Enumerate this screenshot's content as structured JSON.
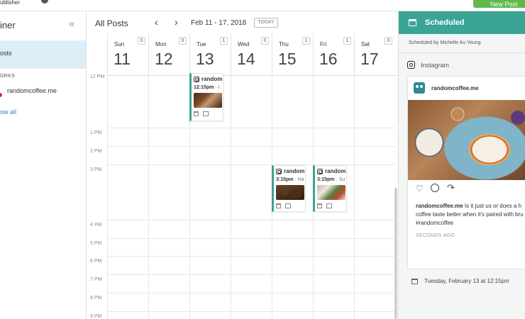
{
  "topbar": {
    "publisher": "ublisher",
    "new_post": "New Post"
  },
  "sidebar": {
    "title": "iner",
    "all_posts": "osts",
    "networks_label": "ORKS",
    "account": "randomcoffee.me",
    "show_all": "ow all"
  },
  "calendar": {
    "title": "All Posts",
    "date_range": "Feb 11 - 17, 2018",
    "today": "TODAY",
    "days": [
      {
        "name": "Sun",
        "num": "11",
        "count": "0"
      },
      {
        "name": "Mon",
        "num": "12",
        "count": "0"
      },
      {
        "name": "Tue",
        "num": "13",
        "count": "1"
      },
      {
        "name": "Wed",
        "num": "14",
        "count": "0"
      },
      {
        "name": "Thu",
        "num": "15",
        "count": "1"
      },
      {
        "name": "Fri",
        "num": "16",
        "count": "1"
      },
      {
        "name": "Sat",
        "num": "17",
        "count": "0"
      }
    ],
    "hours": [
      "12 PM",
      "1 PM",
      "2 PM",
      "3 PM",
      "4 PM",
      "5 PM",
      "6 PM",
      "7 PM",
      "8 PM",
      "9 PM"
    ],
    "posts": [
      {
        "account": "random",
        "time": "12:15pm",
        "caption": " · I"
      },
      {
        "account": "random",
        "time": "3:15pm",
        "caption": " · Ha"
      },
      {
        "account": "random",
        "time": "3:15pm",
        "caption": " · Su"
      }
    ]
  },
  "panel": {
    "title": "Scheduled",
    "scheduled_by": "Scheduled by Michelle Au Yeung",
    "network": "Instagram",
    "post": {
      "account": "randomcoffee.me",
      "caption_user": "randomcoffee.me",
      "caption_line1": " Is it just us or does a h",
      "caption_line2": "coffee taste better when it's paired with bru",
      "caption_line3": "#randomcoffee",
      "ago": "SECONDS AGO"
    },
    "scheduled_time": "Tuesday, February 13 at 12:15pm"
  },
  "colors": {
    "accent": "#3aa594",
    "selected": "#ddeef8",
    "new_post": "#5fb94a",
    "link": "#2f7fbf"
  },
  "icons": {
    "collapse": "collapse-icon",
    "calendar": "calendar-icon",
    "instagram": "instagram-icon",
    "heart": "heart-icon",
    "comment": "comment-icon",
    "share": "share-icon"
  }
}
